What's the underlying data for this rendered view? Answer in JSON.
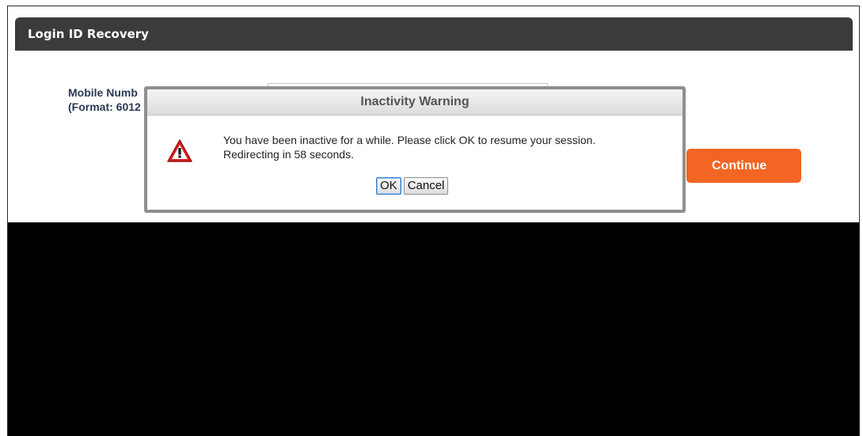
{
  "panel": {
    "title": "Login ID Recovery"
  },
  "form": {
    "label_line1": "Mobile Numb",
    "label_line2": "(Format: 6012",
    "continue_label": "Continue"
  },
  "dialog": {
    "title": "Inactivity Warning",
    "message_line1": "You have been inactive for a while. Please click OK to resume your session.",
    "message_line2": "Redirecting in 58 seconds.",
    "ok_label": "OK",
    "cancel_label": "Cancel",
    "icon": "warning-icon"
  },
  "colors": {
    "header_bg": "#3b3b3b",
    "accent": "#f26522",
    "warning_red": "#d81e1e"
  }
}
